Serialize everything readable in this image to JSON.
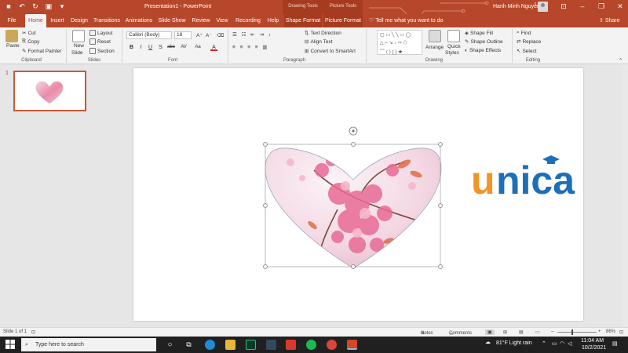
{
  "window": {
    "title": "Presentation1 - PowerPoint",
    "context_tabs": [
      "Drawing Tools",
      "Picture Tools"
    ],
    "user": "Hanh Minh Nguyễn"
  },
  "tabs": [
    "File",
    "Home",
    "Insert",
    "Design",
    "Transitions",
    "Animations",
    "Slide Show",
    "Review",
    "View",
    "Recording",
    "Help",
    "Shape Format",
    "Picture Format"
  ],
  "tell_me": "Tell me what you want to do",
  "share": "Share",
  "ribbon": {
    "clipboard": {
      "label": "Clipboard",
      "paste": "Paste",
      "cut": "Cut",
      "copy": "Copy",
      "format_painter": "Format Painter"
    },
    "slides": {
      "label": "Slides",
      "new_slide": "New",
      "new_slide2": "Slide",
      "layout": "Layout",
      "reset": "Reset",
      "section": "Section"
    },
    "font": {
      "label": "Font",
      "font_name": "Calibri (Body)",
      "font_size": "18",
      "bold": "B",
      "italic": "I",
      "underline": "U",
      "shadow": "S",
      "strike": "abc",
      "spacing": "AV",
      "case": "Aa",
      "color": "A"
    },
    "paragraph": {
      "label": "Paragraph",
      "text_direction": "Text Direction",
      "align_text": "Align Text",
      "convert_smartart": "Convert to SmartArt"
    },
    "drawing": {
      "label": "Drawing",
      "arrange": "Arrange",
      "quick_styles": "Quick",
      "quick_styles2": "Styles",
      "shape_fill": "Shape Fill",
      "shape_outline": "Shape Outline",
      "shape_effects": "Shape Effects"
    },
    "editing": {
      "label": "Editing",
      "find": "Find",
      "replace": "Replace",
      "select": "Select"
    }
  },
  "thumbnails": [
    {
      "number": "1"
    }
  ],
  "logo_text": "unica",
  "statusbar": {
    "slide_info": "Slide 1 of 1",
    "notes": "Notes",
    "comments": "Comments",
    "zoom": "86%"
  },
  "taskbar": {
    "search_placeholder": "Type here to search",
    "weather": "81°F  Light rain",
    "time": "11:04 AM",
    "date": "10/2/2021"
  },
  "colors": {
    "accent": "#b7472a",
    "logo_orange": "#f39324",
    "logo_blue": "#1d6fb8",
    "taskbar": "#202020"
  }
}
